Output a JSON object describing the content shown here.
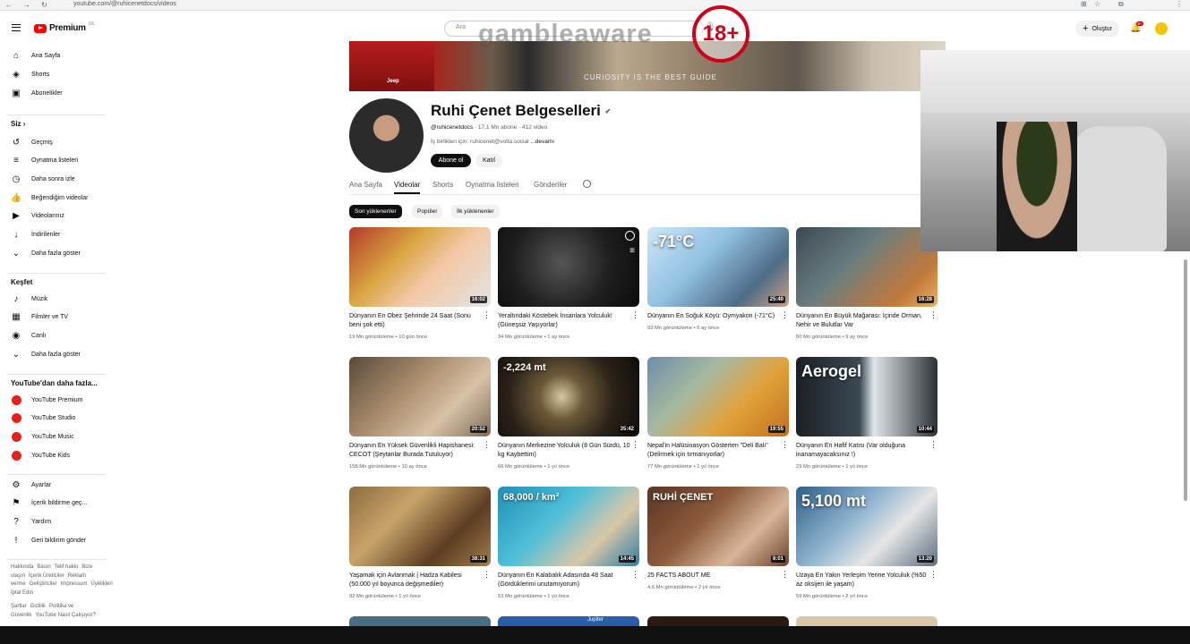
{
  "browser": {
    "url": "youtube.com/@ruhicenetdocs/videos",
    "nav_back": "←",
    "nav_forward": "→",
    "nav_reload": "↻",
    "right_icons": [
      "⊞",
      "☆",
      "⧉",
      "⋮"
    ]
  },
  "header": {
    "logo_text": "Premium",
    "logo_region": "DE",
    "search_placeholder": "Ara",
    "create_label": "Oluştur",
    "notif_count": "9+"
  },
  "overlay": {
    "gamble_text": "gambleaware",
    "age_badge": "18+"
  },
  "banner": {
    "caption": "CURIOSITY IS THE BEST GUIDE",
    "plate": "Jeep"
  },
  "sidebar": {
    "main": [
      {
        "label": "Ana Sayfa",
        "icon": "⌂"
      },
      {
        "label": "Shorts",
        "icon": "◈"
      },
      {
        "label": "Abonelikler",
        "icon": "▣"
      }
    ],
    "you_header": "Siz  ›",
    "you": [
      {
        "label": "Geçmiş",
        "icon": "↺"
      },
      {
        "label": "Oynatma listeleri",
        "icon": "≡"
      },
      {
        "label": "Daha sonra izle",
        "icon": "◷"
      },
      {
        "label": "Beğendiğim videolar",
        "icon": "👍"
      },
      {
        "label": "Videolarınız",
        "icon": "▶"
      },
      {
        "label": "İndirilenler",
        "icon": "↓"
      },
      {
        "label": "Daha fazla göster",
        "icon": "⌄"
      }
    ],
    "explore_header": "Keşfet",
    "explore": [
      {
        "label": "Müzik",
        "icon": "♪"
      },
      {
        "label": "Filmler ve TV",
        "icon": "▦"
      },
      {
        "label": "Canlı",
        "icon": "◉"
      },
      {
        "label": "Daha fazla göster",
        "icon": "⌄"
      }
    ],
    "more_header": "YouTube'dan daha fazla...",
    "more": [
      {
        "label": "YouTube Premium"
      },
      {
        "label": "YouTube Studio"
      },
      {
        "label": "YouTube Music"
      },
      {
        "label": "YouTube Kids"
      }
    ],
    "settings": [
      {
        "label": "Ayarlar",
        "icon": "⚙"
      },
      {
        "label": "İçerik bildirme geç...",
        "icon": "⚑"
      },
      {
        "label": "Yardım",
        "icon": "?"
      },
      {
        "label": "Geri bildirim gönder",
        "icon": "!"
      }
    ],
    "footer1": [
      "Hakkında",
      "Basın",
      "Telif hakkı",
      "Bize ulaşın",
      "İçerik Üreticiler",
      "Reklam verme",
      "Geliştiriciler",
      "Impressum",
      "Üyelikleri İptal Edin"
    ],
    "footer2": [
      "Şartlar",
      "Gizlilik",
      "Politika ve Güvenlik",
      "YouTube Nasıl Çalışıyor?"
    ]
  },
  "channel": {
    "name": "Ruhi Çenet Belgeselleri",
    "verified": "✔",
    "handle": "@ruhicenetdocs",
    "subs": "17,1 Mn abone",
    "videos": "412 video",
    "description": "İş birlikleri için: ruhicenet@volta.social",
    "more": "...devamı",
    "subscribe": "Abone ol",
    "join": "Katıl"
  },
  "tabs": [
    "Ana Sayfa",
    "Videolar",
    "Shorts",
    "Oynatma listeleri",
    "Gönderiler"
  ],
  "chips": [
    "Son yüklenenler",
    "Popüler",
    "İlk yüklenenler"
  ],
  "videos": [
    {
      "title": "Dünyanın En Obez Şehrinde 24 Saat (Sonu beni şok etti)",
      "views": "19 Mn görüntüleme",
      "age": "10 gün önce",
      "duration": "16:02",
      "bg": "linear-gradient(135deg,#b23a2a 0%,#d9a441 35%,#f3c9a8 60%,#e4e4e4 100%)"
    },
    {
      "title": "Yeraltındaki Köstebek İnsanlara Yolculuk! (Güneşsiz Yaşıyorlar)",
      "views": "34 Mn görüntüleme",
      "age": "1 ay önce",
      "duration": "",
      "bg": "radial-gradient(circle at 45% 45%,#555 0%,#1e1e1e 55%,#0b0b0b 100%)"
    },
    {
      "title": "Dünyanın En Soğuk Köyü: Oymyakon (-71°C)",
      "views": "93 Mn görüntüleme",
      "age": "6 ay önce",
      "duration": "25:40",
      "bg": "linear-gradient(135deg,#cfe7f7 0%,#8fc0e2 40%,#4f6b85 75%,#c9a48a 100%)",
      "overlay": "-71°C"
    },
    {
      "title": "Dünyanın En Büyük Mağarası: İçinde Orman, Nehir ve Bulutlar Var",
      "views": "60 Mn görüntüleme",
      "age": "9 ay önce",
      "duration": "16:28",
      "bg": "linear-gradient(135deg,#3b4a52 0%,#6b7c80 40%,#c47a3a 80%,#e9b36a 100%)"
    },
    {
      "title": "Dünyanın En Yüksek Güvenlikli Hapishanesi: CECOT (Şeytanlar Burada Tutuluyor)",
      "views": "158 Mn görüntüleme",
      "age": "10 ay önce",
      "duration": "20:52",
      "bg": "linear-gradient(135deg,#5a4a3a 0%,#a88c6c 40%,#d8c2a6 70%,#7e6b58 100%)"
    },
    {
      "title": "Dünyanın Merkezine Yolculuk (8 Gün Sürdü, 10 kg Kaybettim)",
      "views": "66 Mn görüntüleme",
      "age": "1 yıl önce",
      "duration": "35:42",
      "bg": "radial-gradient(circle at 45% 50%,#d8c9a0 0%,#6e5a3a 25%,#2b2318 60%,#0d0b08 100%)",
      "overlay": "-2,224 mt"
    },
    {
      "title": "Nepal'in Halüsinasyon Gösterten \"Deli Balı\" (Delirmek için tırmanıyorlar)",
      "views": "77 Mn görüntüleme",
      "age": "1 yıl önce",
      "duration": "19:55",
      "bg": "linear-gradient(135deg,#6a8fa8 0%,#a7b9a1 35%,#e0a23a 65%,#c46f1c 100%)"
    },
    {
      "title": "Dünyanın En Hafif Katısı (Var olduğuna inanamayacaksınız !)",
      "views": "23 Mn görüntüleme",
      "age": "1 yıl önce",
      "duration": "10:44",
      "bg": "linear-gradient(90deg,#1a1f24 0%,#3c4a54 45%,#dfe7ea 55%,#2a3238 100%)",
      "overlay": "Aerogel"
    },
    {
      "title": "Yaşamak için Avlanmak | Hadza Kabilesi (50.000 yıl boyunca değişmediler)",
      "views": "92 Mn görüntüleme",
      "age": "1 yıl önce",
      "duration": "38:31",
      "bg": "linear-gradient(135deg,#8c6b3e 0%,#c9a46a 35%,#5b3d22 70%,#a47c4e 100%)"
    },
    {
      "title": "Dünyanın En Kalabalık Adasında 48 Saat (Gördüklerimi unutamıyorum)",
      "views": "53 Mn görüntüleme",
      "age": "1 yıl önce",
      "duration": "14:45",
      "bg": "linear-gradient(135deg,#1f8fb8 0%,#4fc0d8 40%,#d9c8a6 70%,#2f7ea6 100%)",
      "overlay": "68,000 / km²"
    },
    {
      "title": "25 FACTS ABOUT ME",
      "views": "4,6 Mn görüntüleme",
      "age": "2 yıl önce",
      "duration": "8:01",
      "bg": "linear-gradient(135deg,#5a3523 0%,#8c5a3c 40%,#d9b59a 70%,#6a3f2a 100%)",
      "overlay": "RUHİ ÇENET"
    },
    {
      "title": "Uzaya En Yakın Yerleşim Yerine Yolculuk (%50 az oksijen ile yaşam)",
      "views": "59 Mn görüntüleme",
      "age": "2 yıl önce",
      "duration": "13:20",
      "bg": "linear-gradient(135deg,#2f5f8a 0%,#8fb3cf 40%,#e6e6e6 65%,#5b6f80 100%)",
      "overlay": "5,100 mt"
    }
  ],
  "partial_row": [
    {
      "bg": "#4a6f82",
      "text": ""
    },
    {
      "bg": "#2a5ea8",
      "text": "Jupiter"
    },
    {
      "bg": "#2a1a12",
      "text": ""
    },
    {
      "bg": "#d9c7a8",
      "text": ""
    }
  ]
}
